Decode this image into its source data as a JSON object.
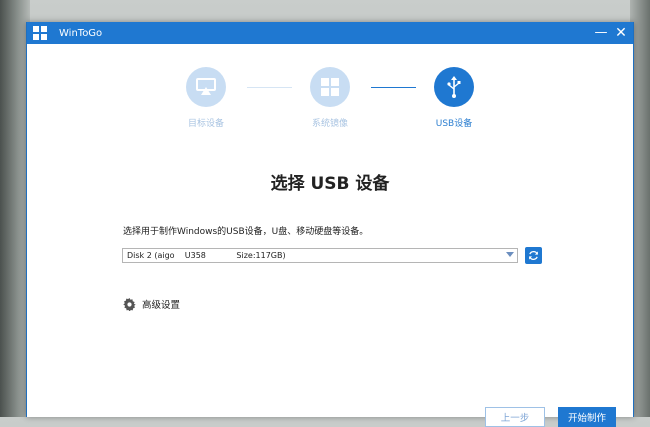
{
  "window": {
    "title": "WinToGo",
    "minimize_label": "—",
    "close_label": "✕"
  },
  "steps": [
    {
      "label": "目标设备",
      "icon": "monitor-icon",
      "state": "done"
    },
    {
      "label": "系统镜像",
      "icon": "windows-icon",
      "state": "done"
    },
    {
      "label": "USB设备",
      "icon": "usb-icon",
      "state": "active"
    }
  ],
  "main": {
    "heading": "选择 USB 设备",
    "description": "选择用于制作Windows的USB设备，U盘、移动硬盘等设备。",
    "disk_selected": "Disk 2 (aigo    U358            Size:117GB)",
    "advanced_label": "高级设置"
  },
  "footer": {
    "prev_label": "上一步",
    "start_label": "开始制作"
  },
  "colors": {
    "accent": "#1f78d1",
    "inactive_step": "#c8ddf3"
  }
}
